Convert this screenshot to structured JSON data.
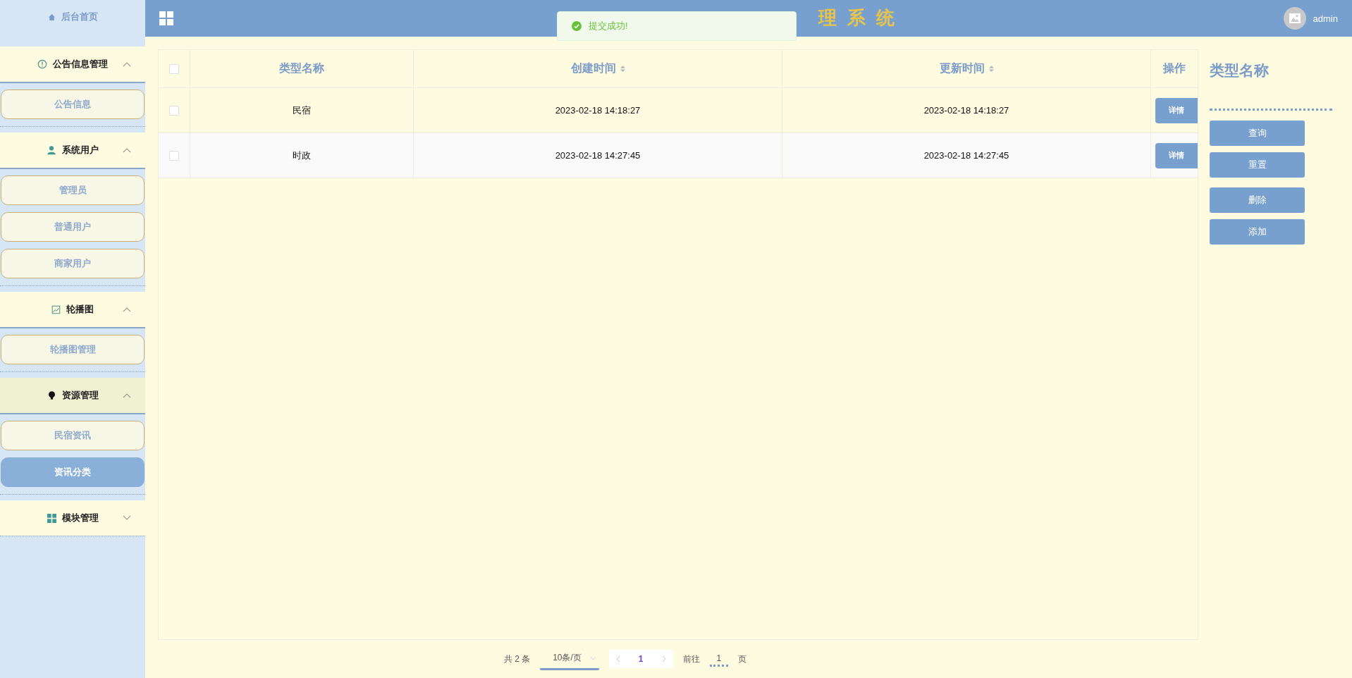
{
  "header": {
    "title": "理 系 统",
    "user": "admin"
  },
  "toast": {
    "message": "提交成功!"
  },
  "sidebar": {
    "home": "后台首页",
    "groups": [
      {
        "label": "公告信息管理",
        "expanded": true,
        "hovered": false,
        "items": [
          {
            "label": "公告信息",
            "selected": false
          }
        ]
      },
      {
        "label": "系统用户",
        "expanded": true,
        "hovered": false,
        "items": [
          {
            "label": "管理员",
            "selected": false
          },
          {
            "label": "普通用户",
            "selected": false
          },
          {
            "label": "商家用户",
            "selected": false
          }
        ]
      },
      {
        "label": "轮播图",
        "expanded": true,
        "hovered": false,
        "items": [
          {
            "label": "轮播图管理",
            "selected": false
          }
        ]
      },
      {
        "label": "资源管理",
        "expanded": true,
        "hovered": true,
        "items": [
          {
            "label": "民宿资讯",
            "selected": false
          },
          {
            "label": "资讯分类",
            "selected": true
          }
        ]
      },
      {
        "label": "模块管理",
        "expanded": false,
        "hovered": false
      }
    ]
  },
  "table": {
    "all_checked": false,
    "columns": [
      {
        "label": "类型名称",
        "sortable": false
      },
      {
        "label": "创建时间",
        "sortable": true
      },
      {
        "label": "更新时间",
        "sortable": true
      },
      {
        "label": "操作",
        "sortable": false
      }
    ],
    "rows": [
      {
        "checked": false,
        "cells": [
          "民宿",
          "2023-02-18 14:18:27",
          "2023-02-18 14:18:27"
        ],
        "action": "详情"
      },
      {
        "checked": false,
        "cells": [
          "时政",
          "2023-02-18 14:27:45",
          "2023-02-18 14:27:45"
        ],
        "action": "详情"
      }
    ]
  },
  "search_panel": {
    "label": "类型名称",
    "buttons": [
      "查询",
      "重置",
      "删除",
      "添加"
    ]
  },
  "pagination": {
    "total": "共 2 条",
    "page_size": "10条/页",
    "pages": [
      {
        "label": "1",
        "selected": true
      }
    ],
    "goto_label": "前往",
    "goto_value": "1",
    "page_label": "页"
  }
}
